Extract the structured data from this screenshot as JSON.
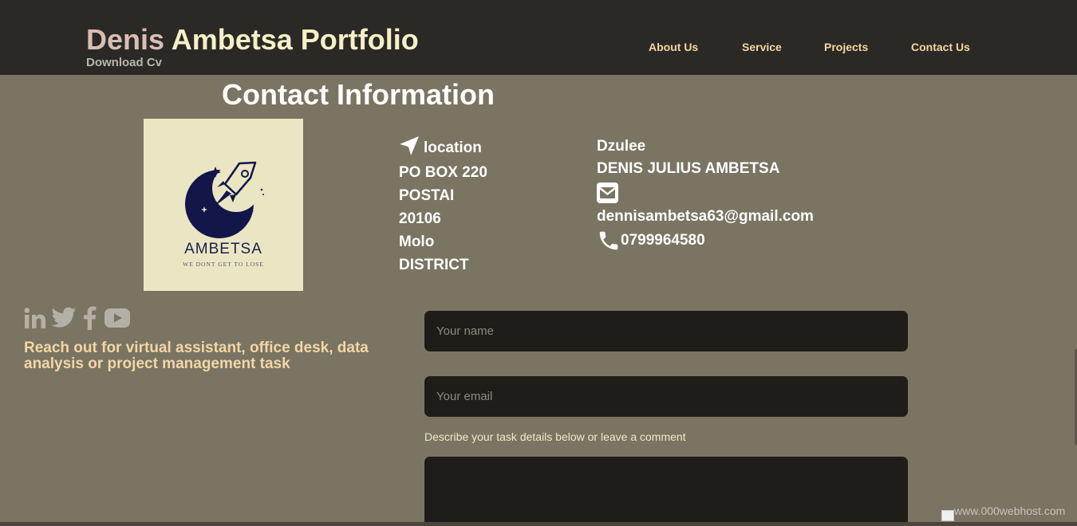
{
  "header": {
    "brand_first": "Denis",
    "brand_rest": "Ambetsa Portfolio",
    "download_cv": "Download Cv",
    "nav": [
      {
        "label": "About Us"
      },
      {
        "label": "Service"
      },
      {
        "label": "Projects"
      },
      {
        "label": "Contact Us"
      }
    ]
  },
  "main": {
    "title": "Contact Information",
    "logo": {
      "name": "AMBETSA",
      "tagline": "WE DONT GET TO LOSE"
    },
    "address": {
      "label": "location",
      "lines": [
        "PO BOX 220",
        "POSTAI",
        "20106",
        "Molo",
        "DISTRICT"
      ]
    },
    "contact": {
      "nickname": "Dzulee",
      "full_name": "DENIS JULIUS AMBETSA",
      "email": "dennisambetsa63@gmail.com",
      "phone": "0799964580"
    },
    "socials": [
      "linkedin-icon",
      "twitter-icon",
      "facebook-icon",
      "youtube-icon"
    ],
    "reach_text": "Reach out for virtual assistant, office desk, data analysis or project management task"
  },
  "form": {
    "name_placeholder": "Your name",
    "email_placeholder": "Your email",
    "describe_label": "Describe your task details below or leave a comment"
  },
  "footer": {
    "badge_text": "www.000webhost.com"
  },
  "colors": {
    "page_bg": "#7a7462",
    "header_bg": "#2b2925",
    "nav_text": "#f3d6a6",
    "field_bg": "#1f1d19"
  }
}
